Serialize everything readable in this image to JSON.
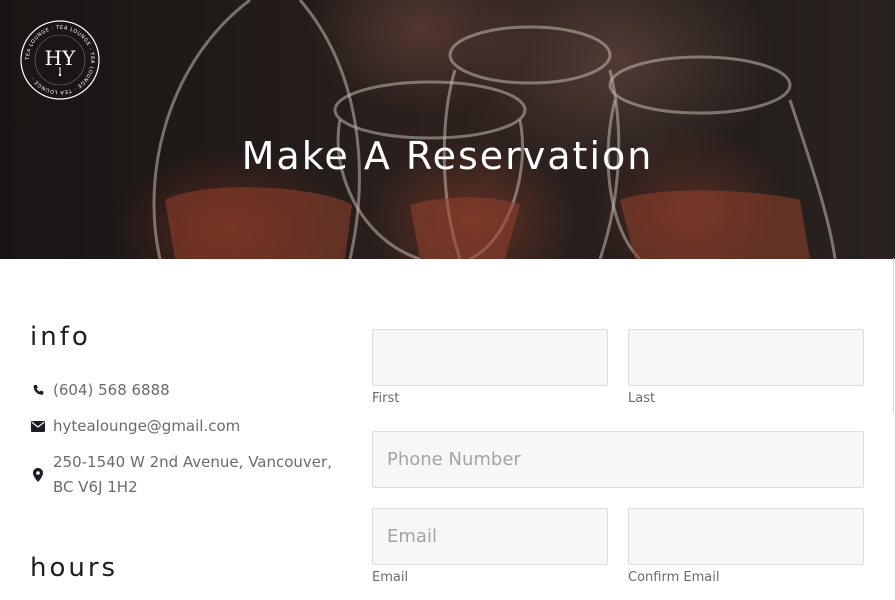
{
  "hero": {
    "title": "Make A Reservation",
    "logo_letters": "HY",
    "logo_ring_text": "TEA LOUNGE · TEA LOUNGE · TEA LOUNGE · TEA LOUNGE ·"
  },
  "info": {
    "heading": "info",
    "phone": "(604) 568 6888",
    "email": "hytealounge@gmail.com",
    "address_line1": "250-1540 W 2nd Avenue, Vancouver,",
    "address_line2": "BC V6J 1H2",
    "icons": [
      "phone-icon",
      "envelope-icon",
      "map-marker-icon"
    ]
  },
  "hours": {
    "heading": "hours"
  },
  "form": {
    "first_label": "First",
    "last_label": "Last",
    "phone_placeholder": "Phone Number",
    "email_placeholder": "Email",
    "email_label": "Email",
    "confirm_email_label": "Confirm Email"
  },
  "colors": {
    "heading": "#1d1d26",
    "body_text": "#6b6b6b",
    "field_bg": "#f7f7f7",
    "field_border": "#dcdcdc"
  }
}
